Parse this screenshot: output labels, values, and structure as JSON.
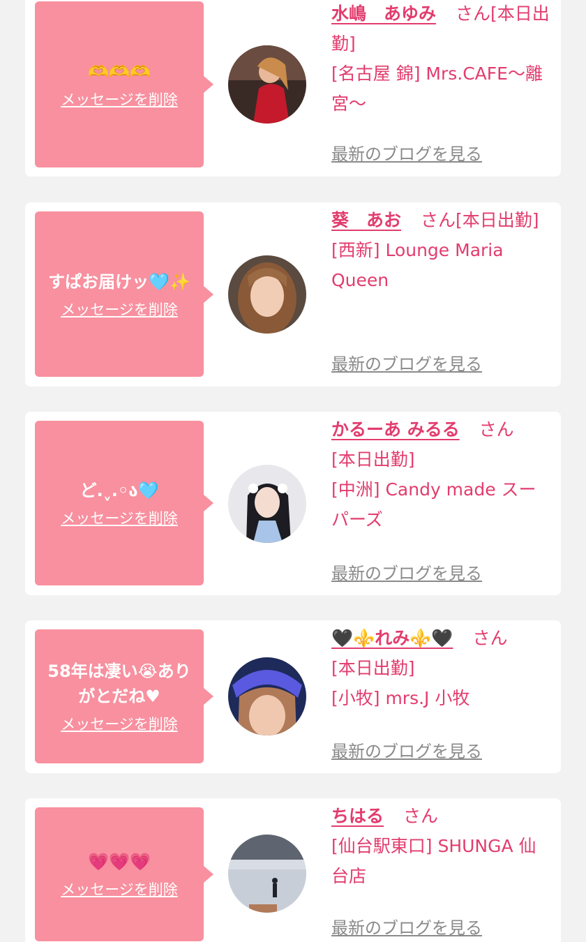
{
  "entries": [
    {
      "message": "🫶🫶🫶",
      "delete_label": "メッセージを削除",
      "name": "水嶋　あゆみ",
      "honorific": "さん",
      "status": "[本日出勤]",
      "shop": "[名古屋 錦] Mrs.CAFE〜離宮〜",
      "blog_label": "最新のブログを見る"
    },
    {
      "message": "すぱお届けッ🩵✨",
      "delete_label": "メッセージを削除",
      "name": "葵　あお",
      "honorific": "さん",
      "status": "[本日出勤]",
      "shop": "[西新] Lounge Maria Queen",
      "blog_label": "最新のブログを見る"
    },
    {
      "message": "ど.ˬ.◦ა🩵",
      "delete_label": "メッセージを削除",
      "name": "かるーあ みるる",
      "honorific": "さん",
      "status": "[本日出勤]",
      "shop": "[中洲] Candy made スーパーズ",
      "blog_label": "最新のブログを見る"
    },
    {
      "message": "58年は凄い😭ありがとだね♥",
      "delete_label": "メッセージを削除",
      "name": "🖤⚜️れみ⚜️🖤",
      "honorific": "さん",
      "status": "[本日出勤]",
      "shop": "[小牧] mrs.J 小牧",
      "blog_label": "最新のブログを見る"
    },
    {
      "message": "💗💗💗",
      "delete_label": "メッセージを削除",
      "name": "ちはる",
      "honorific": "さん",
      "status": "",
      "shop": "[仙台駅東口] SHUNGA 仙台店",
      "blog_label": "最新のブログを見る"
    }
  ],
  "colors": {
    "page_background": "#f2f2f2",
    "bubble": "#f8909f",
    "accent_text": "#e23c6d",
    "blog_link": "#8a8a8a"
  }
}
